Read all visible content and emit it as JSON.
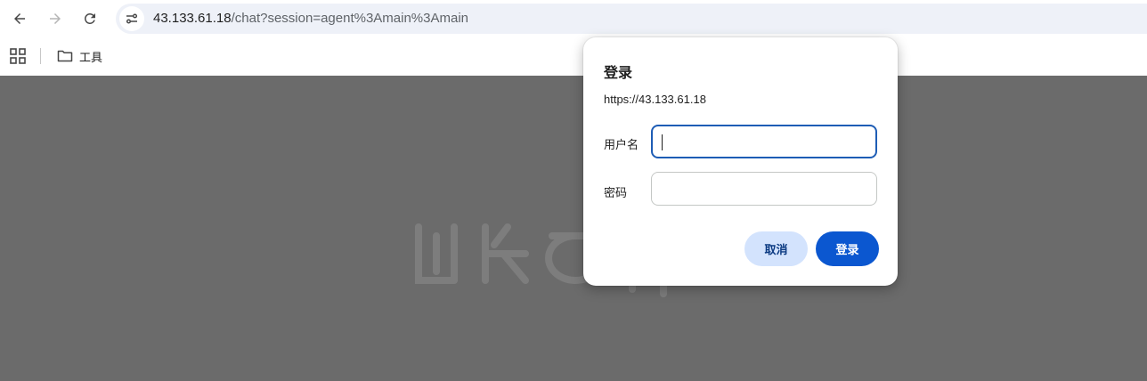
{
  "browser": {
    "url_host": "43.133.61.18",
    "url_path": "/chat?session=agent%3Amain%3Amain"
  },
  "bookmarks": {
    "folder_label": "工具"
  },
  "dialog": {
    "title": "登录",
    "origin": "https://43.133.61.18",
    "username_label": "用户名",
    "username_value": "",
    "password_label": "密码",
    "password_value": "",
    "cancel_label": "取消",
    "login_label": "登录"
  },
  "colors": {
    "primary_button": "#0b57d0",
    "secondary_button": "#d3e3fd",
    "focus_ring": "#1e5db5",
    "page_overlay": "#6b6b6b"
  }
}
